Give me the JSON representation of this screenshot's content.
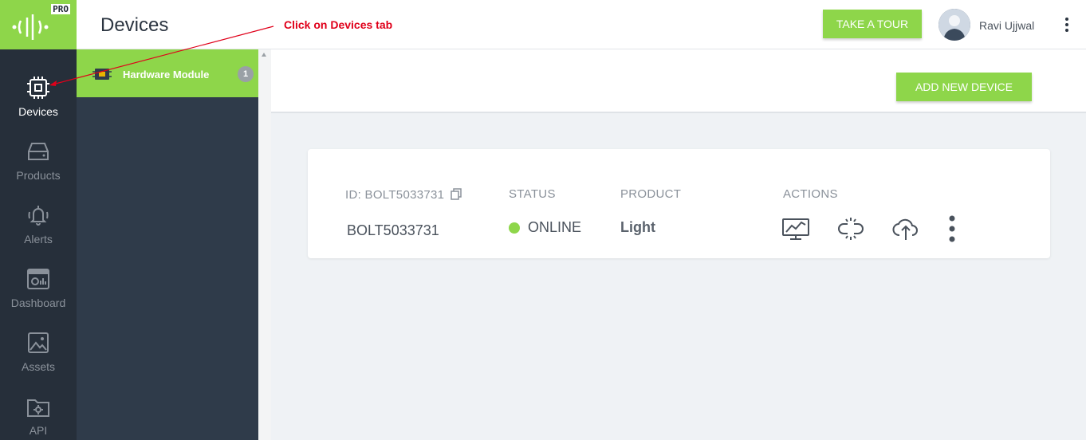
{
  "app": {
    "logo_badge": "PRO",
    "brand_color": "#8ed64a"
  },
  "rail": [
    {
      "label": "Devices",
      "icon": "chip-icon",
      "active": true
    },
    {
      "label": "Products",
      "icon": "products-icon"
    },
    {
      "label": "Alerts",
      "icon": "bell-icon"
    },
    {
      "label": "Dashboard",
      "icon": "dashboard-icon"
    },
    {
      "label": "Assets",
      "icon": "image-icon"
    },
    {
      "label": "API",
      "icon": "folder-gear-icon"
    }
  ],
  "subbar": {
    "item_label": "Hardware Module",
    "item_count": "1"
  },
  "header": {
    "title": "Devices",
    "annotation": "Click on Devices tab",
    "tour_label": "TAKE A TOUR",
    "user_name": "Ravi Ujjwal"
  },
  "toolbar": {
    "add_label": "ADD NEW DEVICE"
  },
  "device": {
    "id_header": "ID: BOLT5033731",
    "id_value": "BOLT5033731",
    "status_header": "STATUS",
    "status_value": "ONLINE",
    "product_header": "PRODUCT",
    "product_value": "Light",
    "actions_header": "ACTIONS"
  }
}
